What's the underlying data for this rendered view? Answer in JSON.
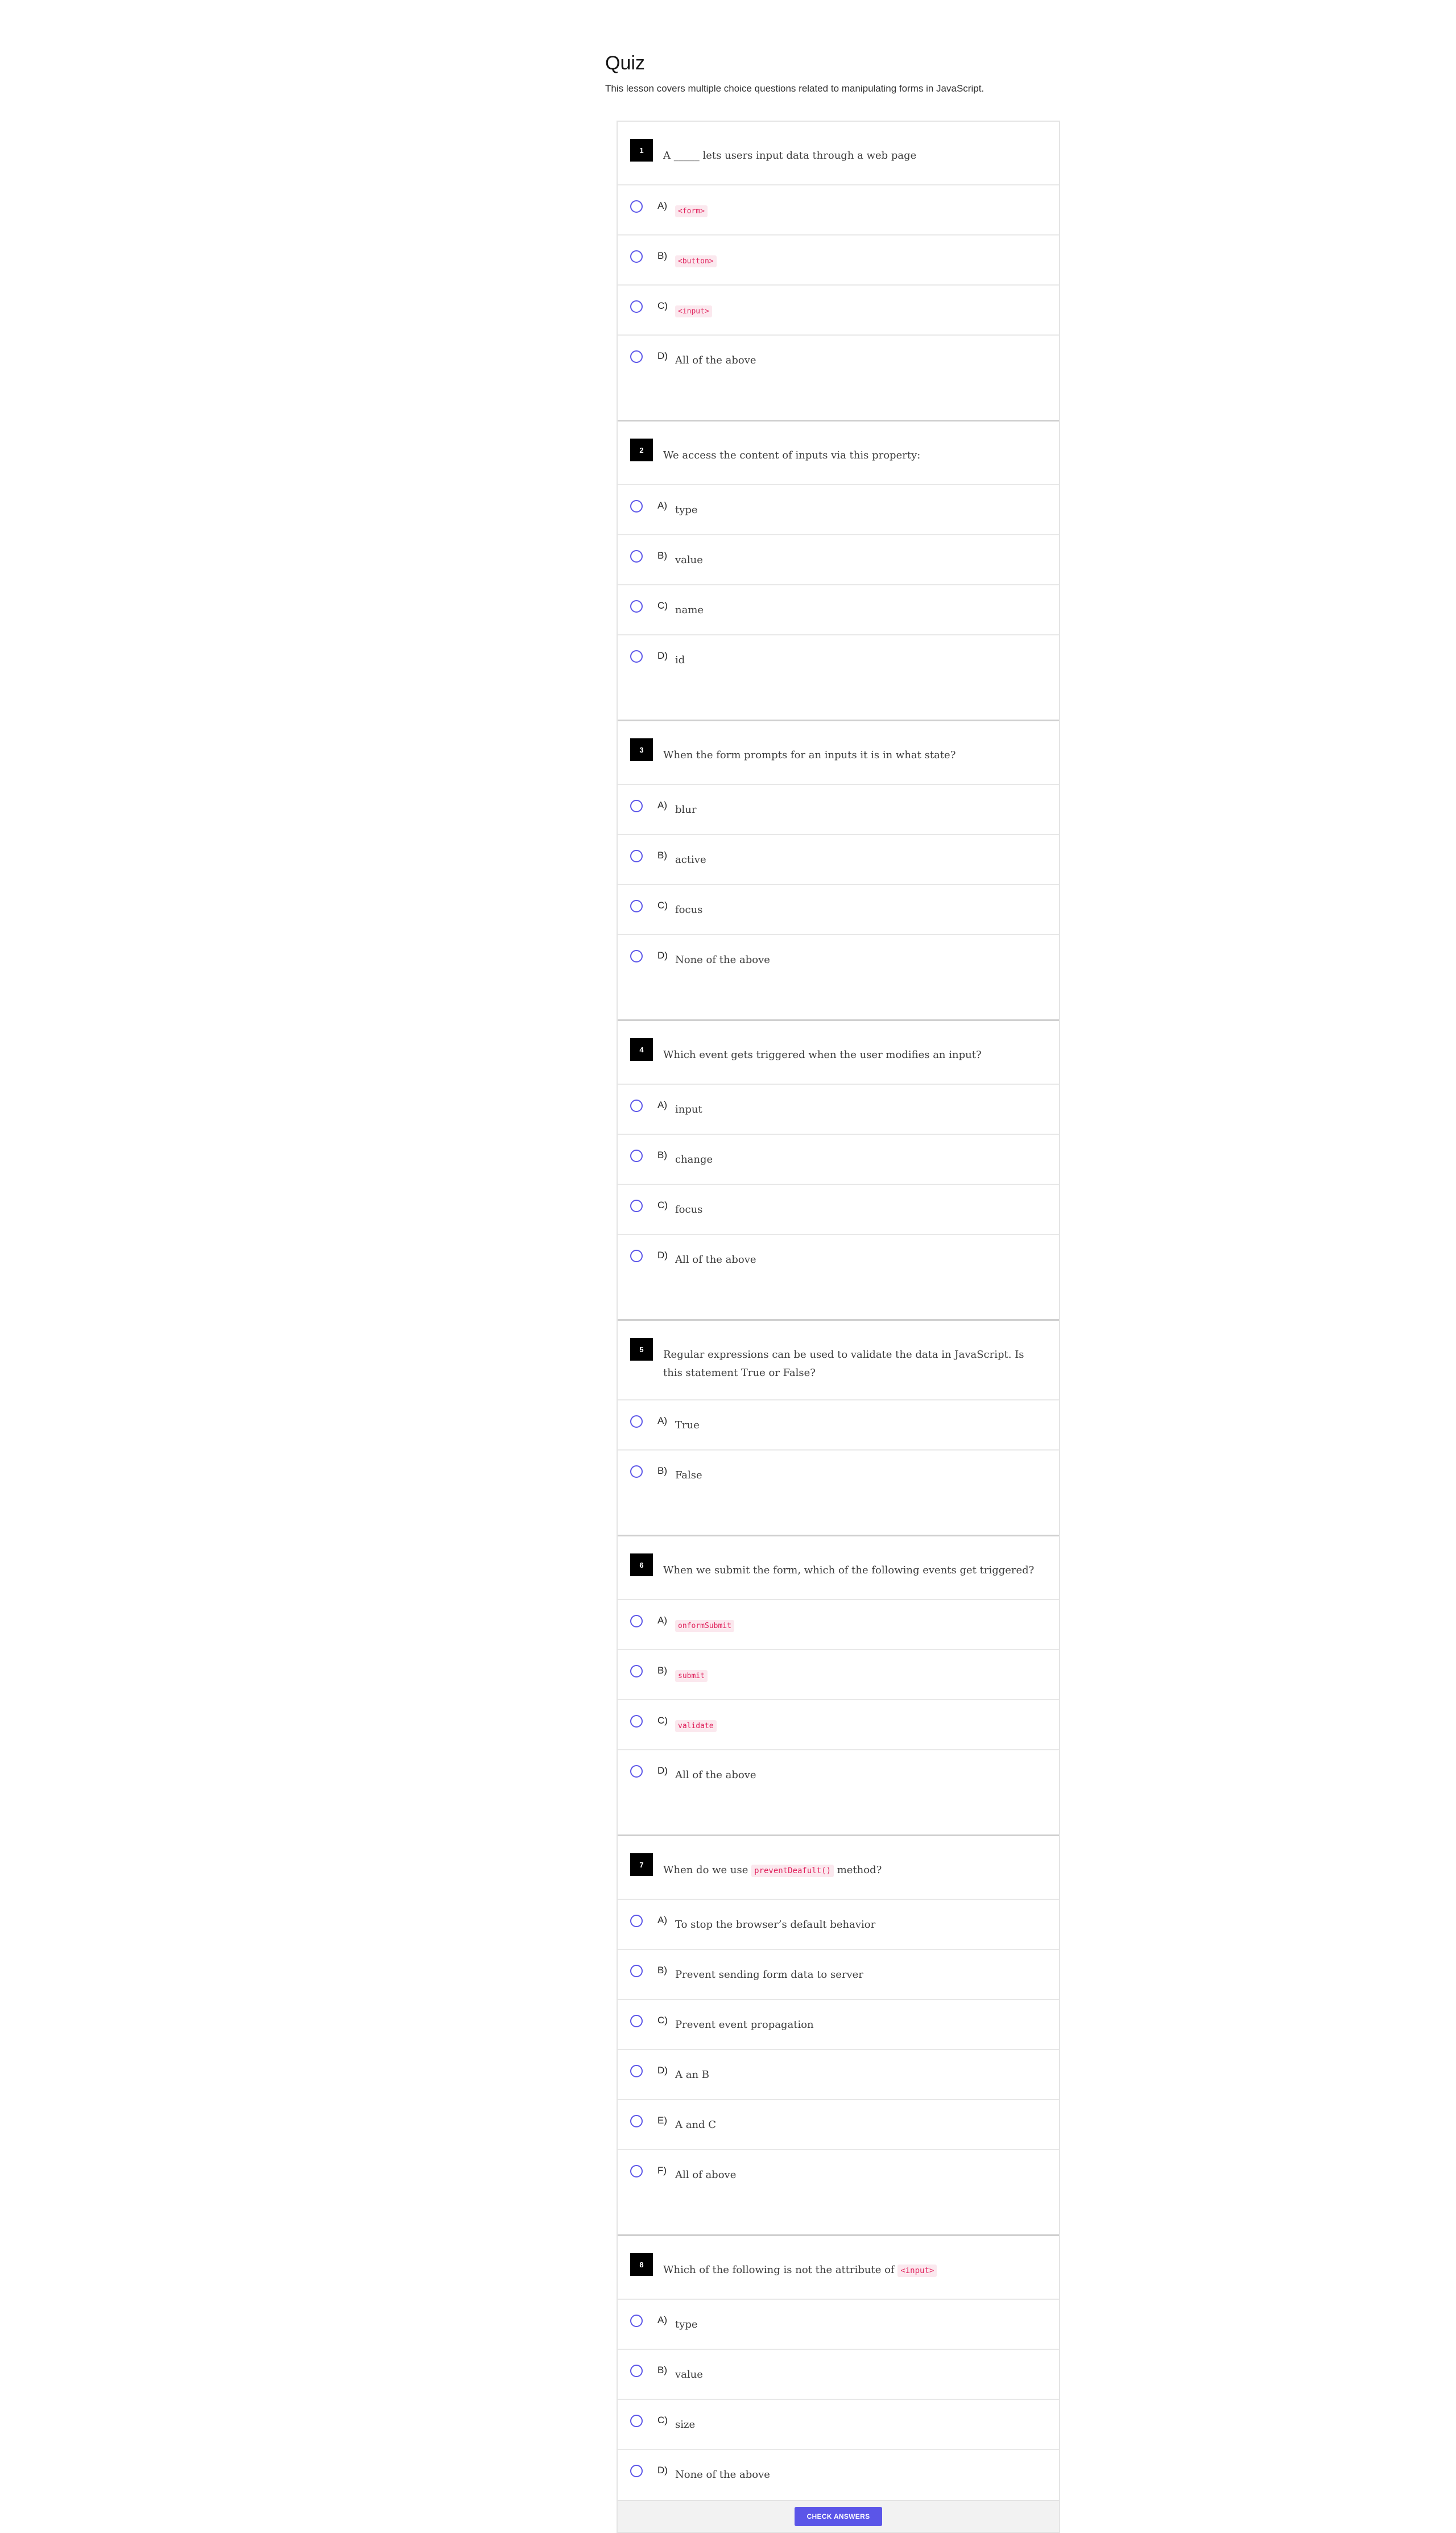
{
  "quiz": {
    "title": "Quiz",
    "description": "This lesson covers multiple choice questions related to manipulating forms in JavaScript.",
    "check_button_label": "CHECK ANSWERS"
  },
  "colors": {
    "accent": "#5b55e8",
    "code_text": "#e0245e",
    "code_bg": "#fbe8ee",
    "number_badge": "#000000"
  },
  "questions": [
    {
      "number": "1",
      "text": [
        {
          "t": "A _____ lets users input data through a web page"
        }
      ],
      "options": [
        {
          "letter": "A)",
          "text": "<form>",
          "code": true
        },
        {
          "letter": "B)",
          "text": "<button>",
          "code": true
        },
        {
          "letter": "C)",
          "text": "<input>",
          "code": true
        },
        {
          "letter": "D)",
          "text": "All of the above",
          "code": false
        }
      ]
    },
    {
      "number": "2",
      "text": [
        {
          "t": "We access the content of inputs via this property:"
        }
      ],
      "options": [
        {
          "letter": "A)",
          "text": "type",
          "code": false
        },
        {
          "letter": "B)",
          "text": "value",
          "code": false
        },
        {
          "letter": "C)",
          "text": "name",
          "code": false
        },
        {
          "letter": "D)",
          "text": "id",
          "code": false
        }
      ]
    },
    {
      "number": "3",
      "text": [
        {
          "t": "When the form prompts for an inputs it is in what state?"
        }
      ],
      "options": [
        {
          "letter": "A)",
          "text": "blur",
          "code": false
        },
        {
          "letter": "B)",
          "text": "active",
          "code": false
        },
        {
          "letter": "C)",
          "text": "focus",
          "code": false
        },
        {
          "letter": "D)",
          "text": "None of the above",
          "code": false
        }
      ]
    },
    {
      "number": "4",
      "text": [
        {
          "t": "Which event gets triggered when the user modifies an input?"
        }
      ],
      "options": [
        {
          "letter": "A)",
          "text": "input",
          "code": false
        },
        {
          "letter": "B)",
          "text": "change",
          "code": false
        },
        {
          "letter": "C)",
          "text": "focus",
          "code": false
        },
        {
          "letter": "D)",
          "text": "All of the above",
          "code": false
        }
      ]
    },
    {
      "number": "5",
      "text": [
        {
          "t": "Regular expressions can be used to validate the data in JavaScript. Is this statement True or False?"
        }
      ],
      "options": [
        {
          "letter": "A)",
          "text": "True",
          "code": false
        },
        {
          "letter": "B)",
          "text": "False",
          "code": false
        }
      ]
    },
    {
      "number": "6",
      "text": [
        {
          "t": "When we submit the form, which of the following events get triggered?"
        }
      ],
      "options": [
        {
          "letter": "A)",
          "text": "onformSubmit",
          "code": true
        },
        {
          "letter": "B)",
          "text": "submit",
          "code": true
        },
        {
          "letter": "C)",
          "text": "validate",
          "code": true
        },
        {
          "letter": "D)",
          "text": "All of the above",
          "code": false
        }
      ]
    },
    {
      "number": "7",
      "text": [
        {
          "t": "When do we use "
        },
        {
          "t": "preventDeafult()",
          "code": true
        },
        {
          "t": " method?"
        }
      ],
      "options": [
        {
          "letter": "A)",
          "text": "To stop the browser’s default behavior",
          "code": false
        },
        {
          "letter": "B)",
          "text": "Prevent sending form data to server",
          "code": false
        },
        {
          "letter": "C)",
          "text": "Prevent event propagation",
          "code": false
        },
        {
          "letter": "D)",
          "text": "A an B",
          "code": false
        },
        {
          "letter": "E)",
          "text": "A and C",
          "code": false
        },
        {
          "letter": "F)",
          "text": "All of above",
          "code": false
        }
      ]
    },
    {
      "number": "8",
      "text": [
        {
          "t": "Which of the following is not the attribute of "
        },
        {
          "t": "<input>",
          "code": true
        }
      ],
      "options": [
        {
          "letter": "A)",
          "text": "type",
          "code": false
        },
        {
          "letter": "B)",
          "text": "value",
          "code": false
        },
        {
          "letter": "C)",
          "text": "size",
          "code": false
        },
        {
          "letter": "D)",
          "text": "None of the above",
          "code": false
        }
      ]
    }
  ]
}
